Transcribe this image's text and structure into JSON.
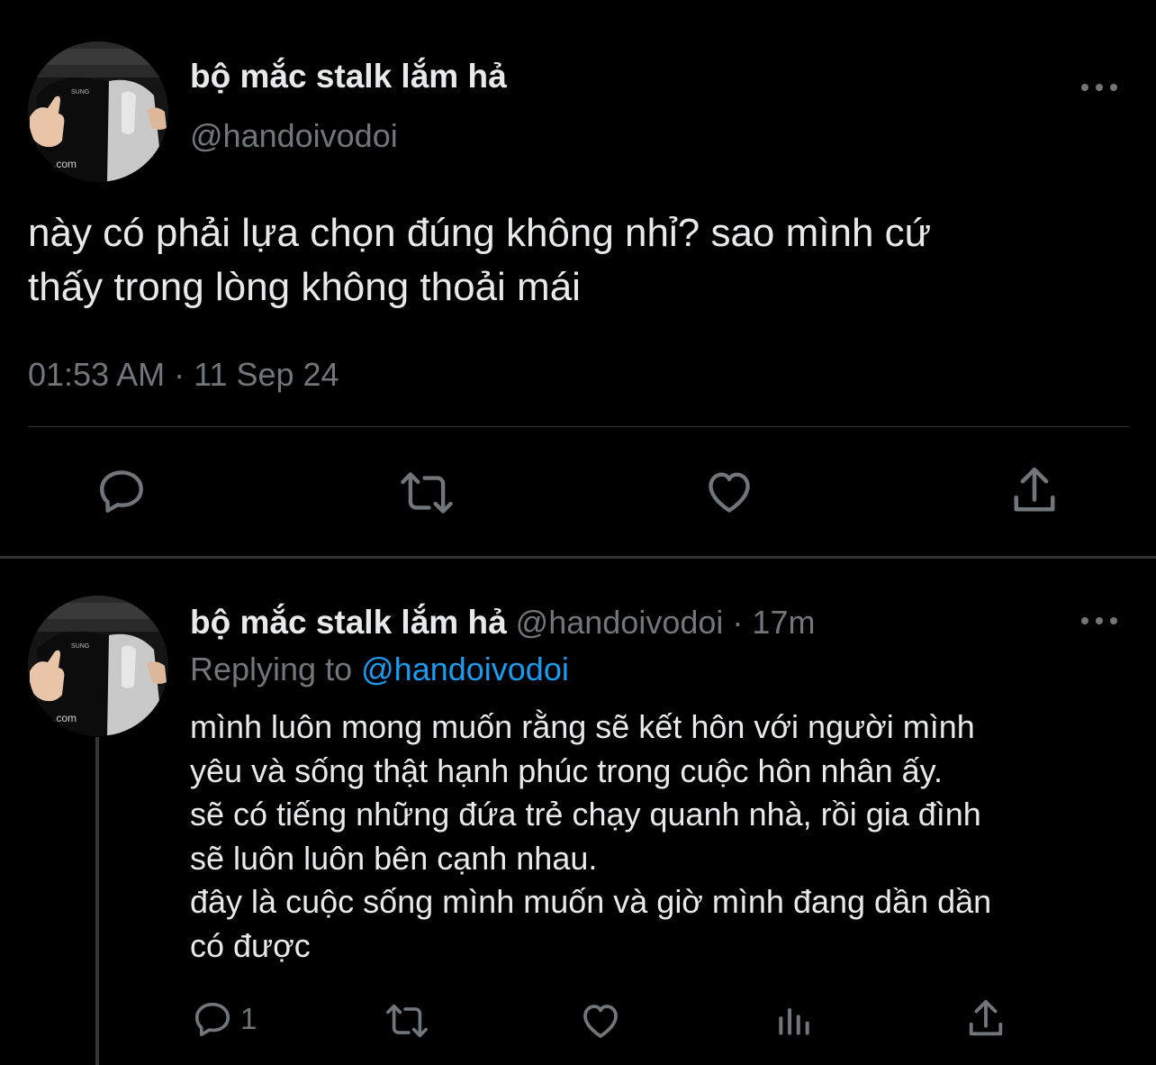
{
  "main_tweet": {
    "display_name": "bộ mắc stalk lắm hả",
    "handle": "@handoivodoi",
    "text": "này có phải lựa chọn đúng không nhỉ? sao mình cứ\nthấy trong lòng không thoải mái",
    "timestamp": "01:53 AM · 11 Sep 24",
    "actions": {
      "reply_icon": "reply-icon",
      "retweet_icon": "retweet-icon",
      "like_icon": "heart-icon",
      "share_icon": "share-icon"
    }
  },
  "reply_tweet": {
    "display_name": "bộ mắc stalk lắm hả",
    "handle": "@handoivodoi",
    "separator": "·",
    "time_ago": "17m",
    "replying_to_label": "Replying to",
    "replying_to_handle": "@handoivodoi",
    "text": "mình luôn mong muốn rằng sẽ kết hôn với người mình\nyêu và sống thật hạnh phúc trong cuộc hôn nhân ấy.\nsẽ có tiếng những đứa trẻ chạy quanh nhà, rồi gia đình\nsẽ luôn luôn bên cạnh nhau.\nđây là cuộc sống mình muốn và giờ mình đang dần dần\ncó được",
    "reply_count": "1",
    "actions": {
      "reply_icon": "reply-icon",
      "retweet_icon": "retweet-icon",
      "like_icon": "heart-icon",
      "stats_icon": "analytics-icon",
      "share_icon": "share-icon"
    }
  },
  "colors": {
    "background": "#000000",
    "text_primary": "#e7e9ea",
    "text_secondary": "#71767b",
    "accent": "#1d9bf0",
    "divider": "#2f3336"
  }
}
